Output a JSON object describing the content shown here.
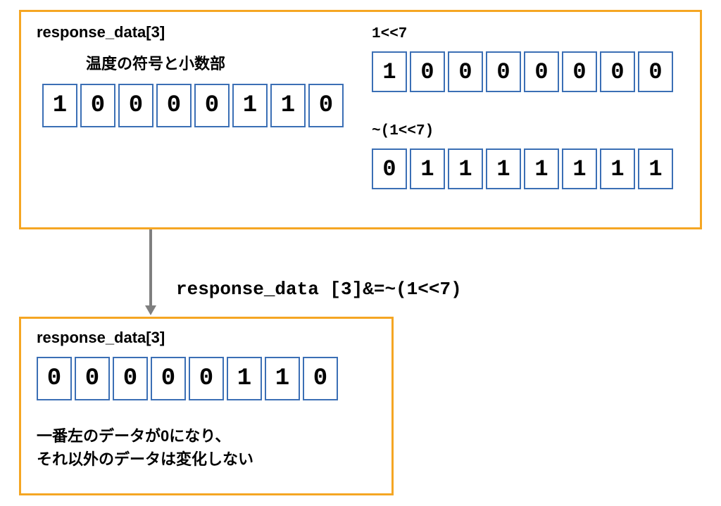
{
  "top_box": {
    "left": {
      "title": "response_data[3]",
      "subtitle": "温度の符号と小数部",
      "bits": [
        "1",
        "0",
        "0",
        "0",
        "0",
        "1",
        "1",
        "0"
      ]
    },
    "right": {
      "mask1_label": "1<<7",
      "mask1_bits": [
        "1",
        "0",
        "0",
        "0",
        "0",
        "0",
        "0",
        "0"
      ],
      "mask2_label": "~(1<<7)",
      "mask2_bits": [
        "0",
        "1",
        "1",
        "1",
        "1",
        "1",
        "1",
        "1"
      ]
    }
  },
  "operation": "response_data [3]&=~(1<<7)",
  "bottom_box": {
    "title": "response_data[3]",
    "bits": [
      "0",
      "0",
      "0",
      "0",
      "0",
      "1",
      "1",
      "0"
    ],
    "note_line1": "一番左のデータが0になり、",
    "note_line2": "それ以外のデータは変化しない"
  }
}
